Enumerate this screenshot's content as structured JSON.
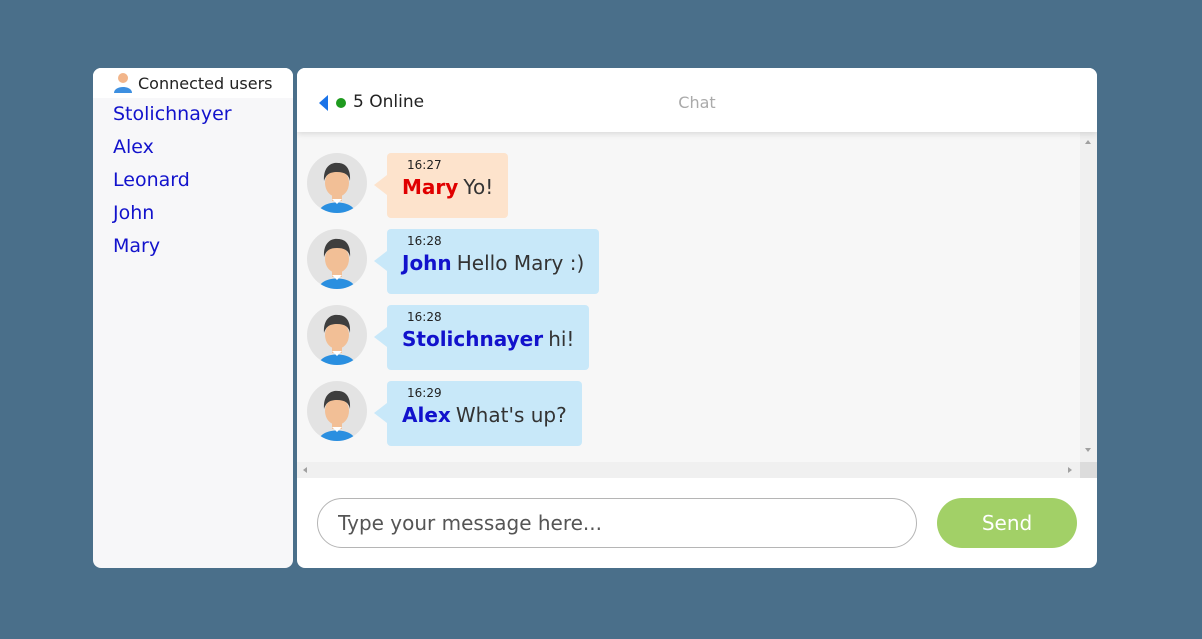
{
  "sidebar": {
    "title": "Connected users",
    "users": [
      "Stolichnayer",
      "Alex",
      "Leonard",
      "John",
      "Mary"
    ]
  },
  "chat": {
    "online_count_text": "5 Online",
    "title": "Chat",
    "messages": [
      {
        "time": "16:27",
        "author": "Mary",
        "text": "Yo!",
        "author_color": "#e00000",
        "bubble_color": "#fde3cc"
      },
      {
        "time": "16:28",
        "author": "John",
        "text": "Hello Mary :)",
        "author_color": "#1212cc",
        "bubble_color": "#c8e8f9"
      },
      {
        "time": "16:28",
        "author": "Stolichnayer",
        "text": "hi!",
        "author_color": "#1212cc",
        "bubble_color": "#c8e8f9"
      },
      {
        "time": "16:29",
        "author": "Alex",
        "text": "What's up?",
        "author_color": "#1212cc",
        "bubble_color": "#c8e8f9"
      }
    ]
  },
  "composer": {
    "placeholder": "Type your message here...",
    "send_label": "Send"
  },
  "colors": {
    "background": "#4a6f8a",
    "online_dot": "#1e9a1e",
    "back_arrow": "#1a73e8",
    "send_button": "#a2d067"
  }
}
